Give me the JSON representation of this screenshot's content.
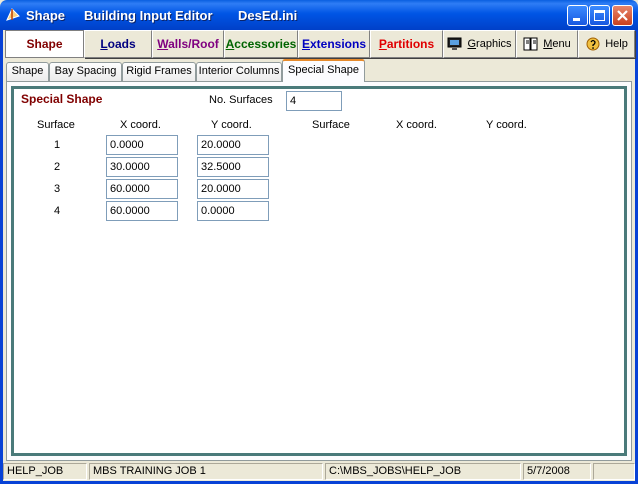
{
  "window": {
    "app_name": "Shape",
    "title": "Building Input Editor",
    "file": "DesEd.ini"
  },
  "toolbar": {
    "shape": {
      "first": "",
      "rest": "Shape"
    },
    "loads": {
      "first": "L",
      "rest": "oads"
    },
    "walls": {
      "first": "W",
      "rest": "alls/Roof"
    },
    "accessories": {
      "first": "A",
      "rest": "ccessories"
    },
    "extensions": {
      "first": "E",
      "rest": "xtensions"
    },
    "partitions": {
      "first": "P",
      "rest": "artitions"
    },
    "graphics": {
      "first": "G",
      "rest": "raphics"
    },
    "menu": {
      "first": "M",
      "rest": "enu"
    },
    "help": {
      "first": "",
      "rest": "Help"
    },
    "colors": {
      "shape": "#800000",
      "loads": "#000080",
      "walls": "#800080",
      "accessories": "#006400",
      "extensions": "#0000c0",
      "partitions": "#e00000"
    }
  },
  "tabs": [
    {
      "label": "Shape"
    },
    {
      "label": "Bay Spacing"
    },
    {
      "label": "Rigid Frames"
    },
    {
      "label": "Interior Columns"
    },
    {
      "label": "Special Shape",
      "active": true
    }
  ],
  "special_shape": {
    "section_title": "Special Shape",
    "no_surfaces_label": "No. Surfaces",
    "no_surfaces_value": "4",
    "headers": {
      "surface": "Surface",
      "x": "X coord.",
      "y": "Y coord.",
      "surface2": "Surface",
      "x2": "X coord.",
      "y2": "Y coord."
    },
    "rows": [
      {
        "surface": "1",
        "x": "0.0000",
        "y": "20.0000"
      },
      {
        "surface": "2",
        "x": "30.0000",
        "y": "32.5000"
      },
      {
        "surface": "3",
        "x": "60.0000",
        "y": "20.0000"
      },
      {
        "surface": "4",
        "x": "60.0000",
        "y": "0.0000"
      }
    ]
  },
  "status": {
    "job": "HELP_JOB",
    "description": "MBS TRAINING JOB 1",
    "path": "C:\\MBS_JOBS\\HELP_JOB",
    "date": "5/7/2008"
  }
}
